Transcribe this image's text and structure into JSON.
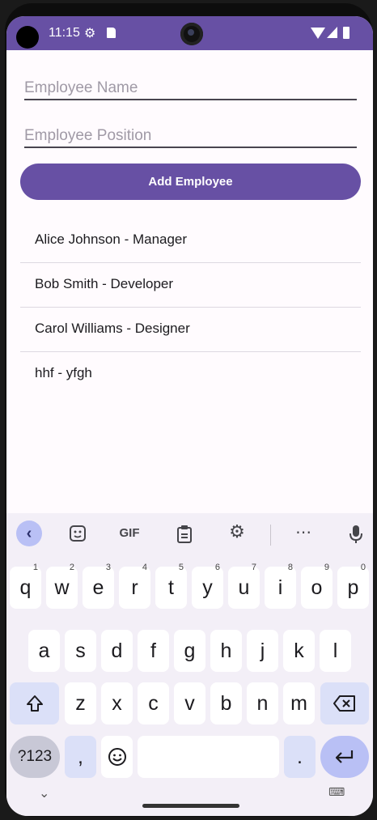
{
  "status": {
    "time": "11:15"
  },
  "form": {
    "name_placeholder": "Employee Name",
    "position_placeholder": "Employee Position",
    "add_button": "Add Employee"
  },
  "employees": [
    "Alice Johnson - Manager",
    "Bob Smith - Developer",
    "Carol Williams - Designer",
    "hhf - yfgh"
  ],
  "keyboard": {
    "toolbar": {
      "gif": "GIF",
      "more": "⋯"
    },
    "row1": [
      {
        "key": "q",
        "hint": "1"
      },
      {
        "key": "w",
        "hint": "2"
      },
      {
        "key": "e",
        "hint": "3"
      },
      {
        "key": "r",
        "hint": "4"
      },
      {
        "key": "t",
        "hint": "5"
      },
      {
        "key": "y",
        "hint": "6"
      },
      {
        "key": "u",
        "hint": "7"
      },
      {
        "key": "i",
        "hint": "8"
      },
      {
        "key": "o",
        "hint": "9"
      },
      {
        "key": "p",
        "hint": "0"
      }
    ],
    "row2": [
      "a",
      "s",
      "d",
      "f",
      "g",
      "h",
      "j",
      "k",
      "l"
    ],
    "row3": [
      "z",
      "x",
      "c",
      "v",
      "b",
      "n",
      "m"
    ],
    "symbols_key": "?123",
    "comma_key": ",",
    "period_key": "."
  },
  "colors": {
    "accent": "#6750a4",
    "background": "#fffbfe",
    "keyboard": "#f3eff7"
  },
  "icons": [
    "gear-icon",
    "sd-card-icon",
    "wifi-icon",
    "signal-icon",
    "battery-icon",
    "back-chevron-icon",
    "sticker-icon",
    "clipboard-icon",
    "settings-icon",
    "mic-icon",
    "shift-icon",
    "backspace-icon",
    "emoji-icon",
    "enter-icon",
    "keyboard-icon"
  ]
}
